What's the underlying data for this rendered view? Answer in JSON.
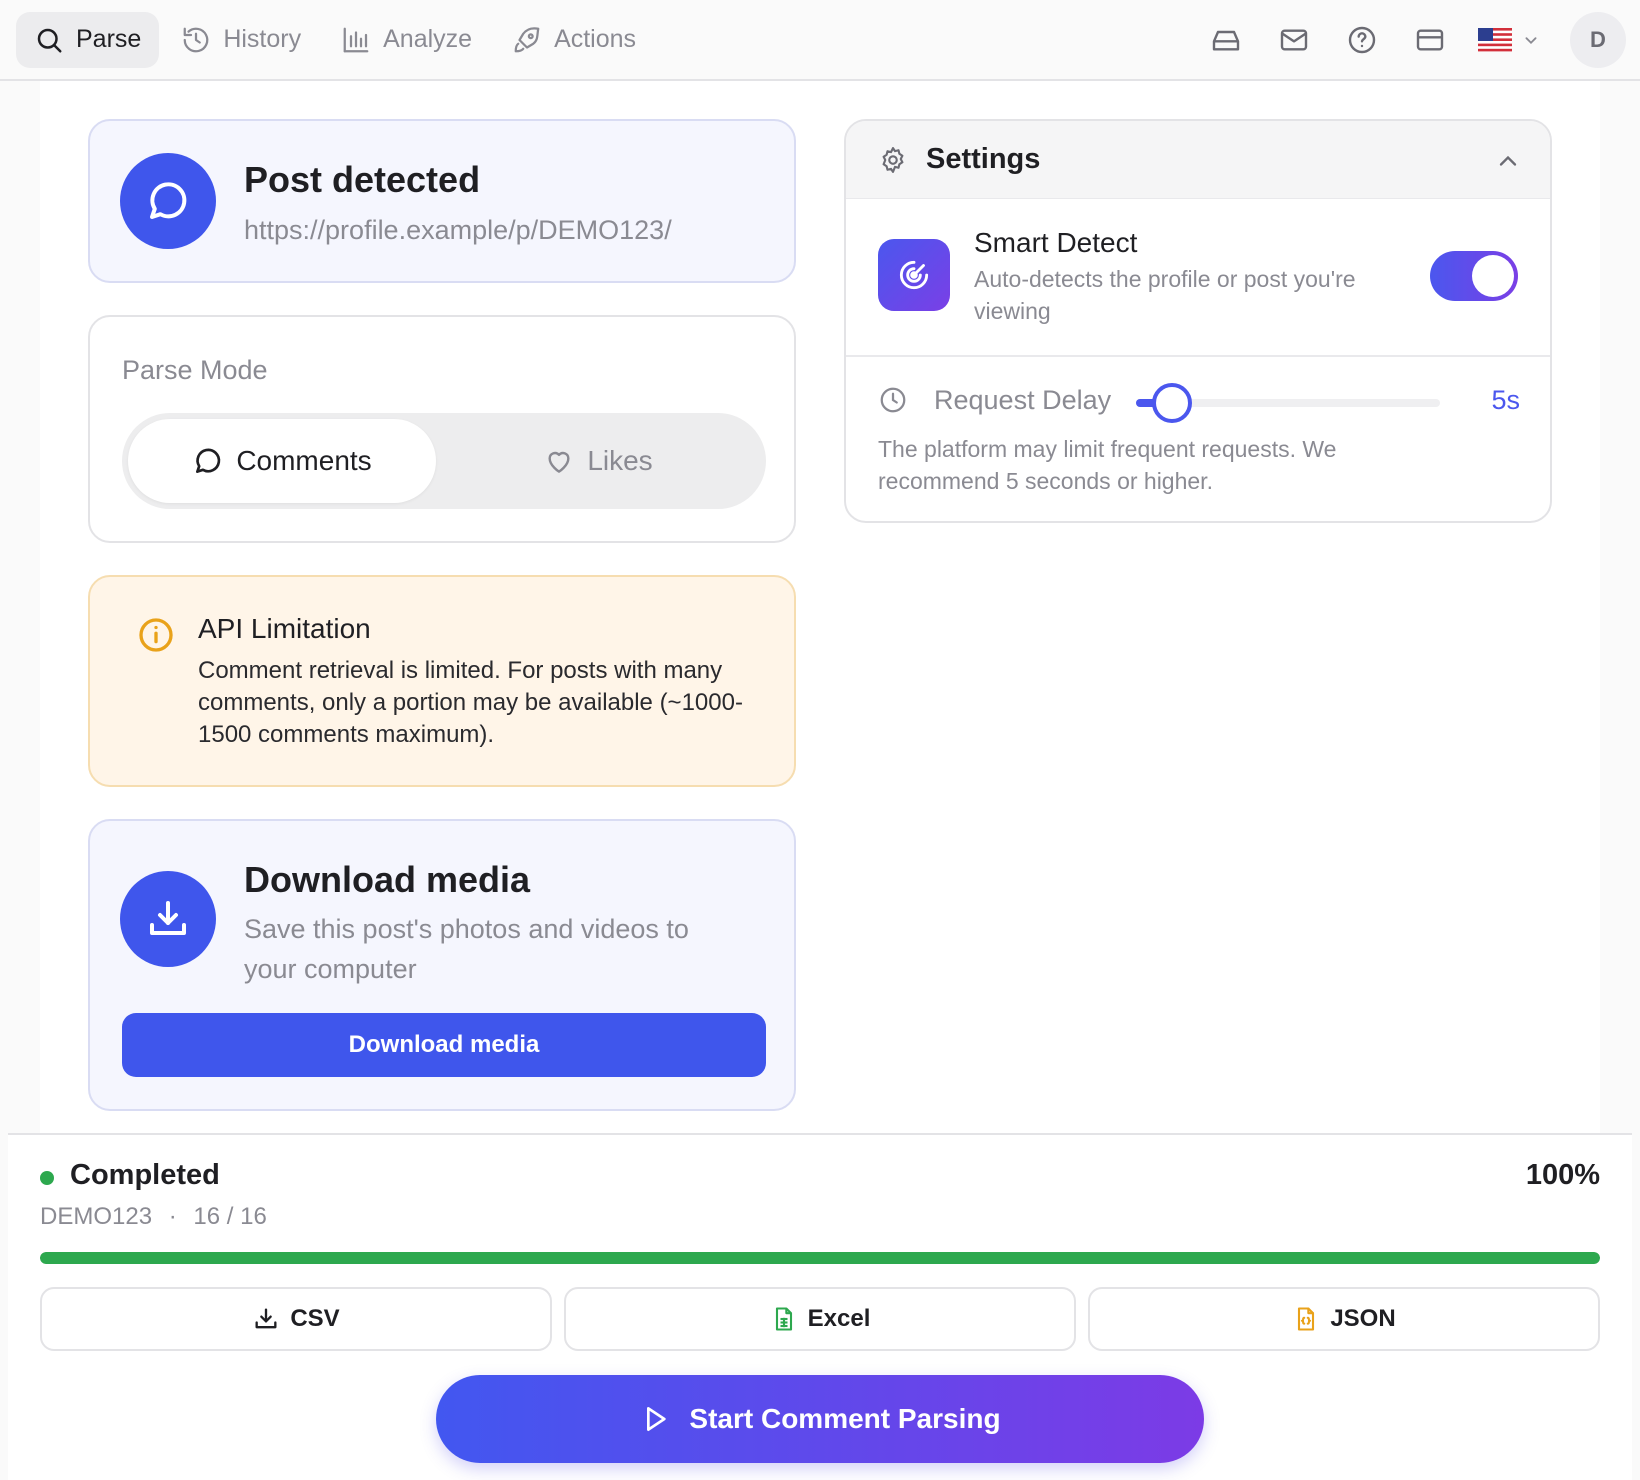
{
  "nav": {
    "tabs": [
      {
        "label": "Parse",
        "icon": "search-icon",
        "active": true
      },
      {
        "label": "History",
        "icon": "history-icon",
        "active": false
      },
      {
        "label": "Analyze",
        "icon": "bar-chart-icon",
        "active": false
      },
      {
        "label": "Actions",
        "icon": "rocket-icon",
        "active": false
      }
    ],
    "right_icons": [
      "inbox-tray-icon",
      "mail-icon",
      "help-circle-icon",
      "credit-card-icon"
    ],
    "language_flag": "us-flag-icon",
    "avatar_initial": "D"
  },
  "post": {
    "title": "Post detected",
    "url": "https://profile.example/p/DEMO123/"
  },
  "parse_mode": {
    "label": "Parse Mode",
    "options": [
      "Comments",
      "Likes"
    ],
    "selected": "Comments"
  },
  "warning": {
    "title": "API Limitation",
    "text": "Comment retrieval is limited. For posts with many comments, only a portion may be available (~1000-1500 comments maximum)."
  },
  "download": {
    "title": "Download media",
    "subtitle": "Save this post's photos and videos to your computer",
    "button": "Download media"
  },
  "settings": {
    "title": "Settings",
    "smart_detect": {
      "title": "Smart Detect",
      "description": "Auto-detects the profile or post you're viewing",
      "enabled": true
    },
    "request_delay": {
      "label": "Request Delay",
      "value": "5s",
      "seconds": 5,
      "min": 3,
      "max": 30,
      "note": "The platform may limit frequent requests. We recommend 5 seconds or higher."
    }
  },
  "status": {
    "state": "Completed",
    "percent": "100%",
    "progress": 1.0,
    "job_id": "DEMO123",
    "separator": "·",
    "count": "16 / 16"
  },
  "exports": [
    "CSV",
    "Excel",
    "JSON"
  ],
  "start_button": "Start Comment Parsing",
  "colors": {
    "accent": "#3f56ec",
    "gradient_end": "#7c3be6",
    "success": "#2da84e",
    "warning_bg": "#fff5e8",
    "warning_icon": "#e9a21a",
    "excel_icon": "#2da84e",
    "json_icon": "#e9a21a"
  }
}
